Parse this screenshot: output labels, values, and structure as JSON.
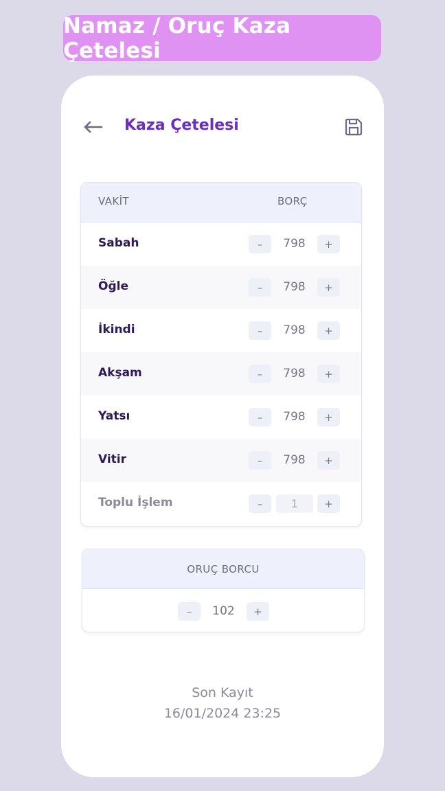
{
  "banner": {
    "title": "Namaz / Oruç Kaza Çetelesi"
  },
  "header": {
    "title": "Kaza Çetelesi",
    "back_icon": "arrow-left-icon",
    "save_icon": "floppy-disk-icon"
  },
  "table": {
    "col_vakit": "VAKİT",
    "col_borc": "BORÇ",
    "rows": [
      {
        "label": "Sabah",
        "value": "798"
      },
      {
        "label": "Öğle",
        "value": "798"
      },
      {
        "label": "İkindi",
        "value": "798"
      },
      {
        "label": "Akşam",
        "value": "798"
      },
      {
        "label": "Yatsı",
        "value": "798"
      },
      {
        "label": "Vitir",
        "value": "798"
      }
    ],
    "bulk": {
      "label": "Toplu İşlem",
      "value": "1"
    }
  },
  "stepper": {
    "minus": "–",
    "plus": "+"
  },
  "fast": {
    "title": "ORUÇ BORCU",
    "value": "102"
  },
  "footer": {
    "label": "Son Kayıt",
    "timestamp": "16/01/2024 23:25"
  },
  "colors": {
    "accent": "#6b2ec0",
    "banner": "#df92f2",
    "background": "#dcd9e8"
  }
}
